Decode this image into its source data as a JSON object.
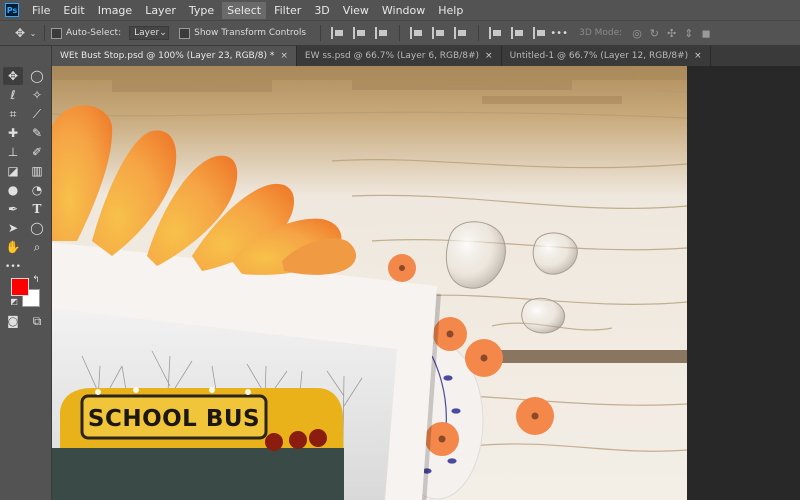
{
  "app": {
    "logo": "Ps"
  },
  "menu": [
    "File",
    "Edit",
    "Image",
    "Layer",
    "Type",
    "Select",
    "Filter",
    "3D",
    "View",
    "Window",
    "Help"
  ],
  "options": {
    "auto_select_label": "Auto-Select:",
    "auto_select_value": "Layer",
    "show_transform_label": "Show Transform Controls",
    "mode_3d_label": "3D Mode:"
  },
  "tabs": [
    {
      "label": "WEt Bust Stop.psd @ 100% (Layer 23, RGB/8) *",
      "close": "×"
    },
    {
      "label": "EW ss.psd @ 66.7% (Layer 6, RGB/8#)",
      "close": "×"
    },
    {
      "label": "Untitled-1 @ 66.7% (Layer 12, RGB/8#)",
      "close": "×"
    }
  ],
  "tools": [
    "move-tool",
    "marquee-tool",
    "lasso-tool",
    "magic-wand-tool",
    "crop-tool",
    "eyedropper-tool",
    "healing-tool",
    "brush-tool",
    "stamp-tool",
    "history-brush-tool",
    "eraser-tool",
    "gradient-tool",
    "blur-tool",
    "dodge-tool",
    "pen-tool",
    "type-tool",
    "path-select-tool",
    "shape-tool",
    "hand-tool",
    "zoom-tool",
    "more-tools"
  ],
  "colors": {
    "foreground": "#ff0000",
    "background": "#ffffff"
  },
  "canvas": {
    "sign_text": "SCHOOL BUS"
  }
}
